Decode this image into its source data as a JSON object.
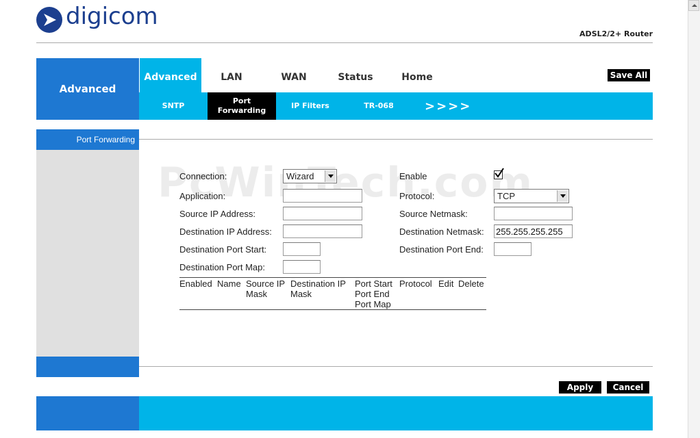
{
  "brand": {
    "logo_text": "digicom",
    "product": "ADSL2/2+ Router"
  },
  "header": {
    "section_title": "Advanced",
    "tabs": [
      "Advanced",
      "LAN",
      "WAN",
      "Status",
      "Home"
    ],
    "save_all": "Save All",
    "subtabs": [
      "SNTP",
      "Port Forwarding",
      "IP Filters",
      "TR-068"
    ],
    "more": ">>>>"
  },
  "sidebar": {
    "items": [
      "Port Forwarding"
    ]
  },
  "watermark": "PcWinTech.com",
  "form": {
    "connection": {
      "label": "Connection:",
      "value": "Wizard"
    },
    "enable": {
      "label": "Enable",
      "checked": true
    },
    "application": {
      "label": "Application:",
      "value": ""
    },
    "protocol": {
      "label": "Protocol:",
      "value": "TCP"
    },
    "source_ip": {
      "label": "Source IP Address:",
      "value": ""
    },
    "source_netmask": {
      "label": "Source Netmask:",
      "value": ""
    },
    "dest_ip": {
      "label": "Destination IP Address:",
      "value": ""
    },
    "dest_netmask": {
      "label": "Destination Netmask:",
      "value": "255.255.255.255"
    },
    "dest_port_start": {
      "label": "Destination Port Start:",
      "value": ""
    },
    "dest_port_end": {
      "label": "Destination Port End:",
      "value": ""
    },
    "dest_port_map": {
      "label": "Destination Port Map:",
      "value": ""
    }
  },
  "table": {
    "columns": {
      "enabled": "Enabled",
      "name": "Name",
      "source_ip": "Source IP",
      "source_mask": "Mask",
      "dest_ip": "Destination IP",
      "dest_mask": "Mask",
      "port_start": "Port Start",
      "port_end": "Port End",
      "port_map": "Port Map",
      "protocol": "Protocol",
      "edit": "Edit",
      "delete": "Delete"
    },
    "rows": []
  },
  "actions": {
    "apply": "Apply",
    "cancel": "Cancel"
  },
  "colors": {
    "primary_blue": "#1e78d2",
    "cyan": "#00b4e8",
    "logo_navy": "#1c3f8f"
  }
}
